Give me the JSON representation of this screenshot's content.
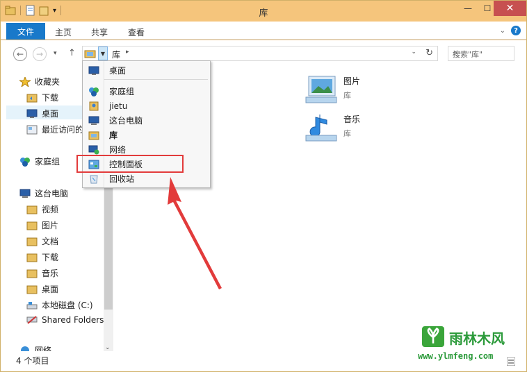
{
  "window": {
    "title": "库"
  },
  "ribbon": {
    "file_tab": "文件",
    "tabs": [
      "主页",
      "共享",
      "查看"
    ]
  },
  "address": {
    "location": "库"
  },
  "search": {
    "placeholder": "搜索\"库\""
  },
  "sidebar": {
    "items": [
      {
        "label": "收藏夹",
        "icon": "star-icon"
      },
      {
        "label": "下载",
        "icon": "folder-icon"
      },
      {
        "label": "桌面",
        "icon": "desktop-icon"
      },
      {
        "label": "最近访问的",
        "icon": "recent-places-icon"
      },
      {
        "label": "家庭组",
        "icon": "homegroup-icon"
      },
      {
        "label": "这台电脑",
        "icon": "computer-icon"
      },
      {
        "label": "视频",
        "icon": "folder-icon"
      },
      {
        "label": "图片",
        "icon": "folder-icon"
      },
      {
        "label": "文档",
        "icon": "folder-icon"
      },
      {
        "label": "下载",
        "icon": "folder-icon"
      },
      {
        "label": "音乐",
        "icon": "folder-icon"
      },
      {
        "label": "桌面",
        "icon": "folder-icon"
      },
      {
        "label": "本地磁盘 (C:)",
        "icon": "drive-icon"
      },
      {
        "label": "Shared Folders",
        "icon": "network-drive-icon"
      },
      {
        "label": "网络",
        "icon": "network-icon"
      }
    ]
  },
  "libraries": [
    {
      "name": "图片",
      "type": "库",
      "icon": "pictures-library-icon"
    },
    {
      "name": "音乐",
      "type": "库",
      "icon": "music-library-icon"
    }
  ],
  "dropdown": {
    "items": [
      {
        "label": "桌面",
        "icon": "desktop-icon"
      },
      {
        "label": "家庭组",
        "icon": "homegroup-icon"
      },
      {
        "label": "jietu",
        "icon": "user-folder-icon"
      },
      {
        "label": "这台电脑",
        "icon": "computer-icon"
      },
      {
        "label": "库",
        "icon": "library-icon"
      },
      {
        "label": "网络",
        "icon": "network-icon"
      },
      {
        "label": "控制面板",
        "icon": "control-panel-icon"
      },
      {
        "label": "回收站",
        "icon": "recycle-bin-icon"
      }
    ]
  },
  "status": {
    "item_count": "4 个项目"
  },
  "watermark": {
    "brand": "雨林木风",
    "url": "www.ylmfeng.com"
  },
  "colors": {
    "accent": "#1979ca",
    "titlebar": "#f5c57c",
    "highlight": "#e23b3b",
    "close": "#c75050"
  }
}
